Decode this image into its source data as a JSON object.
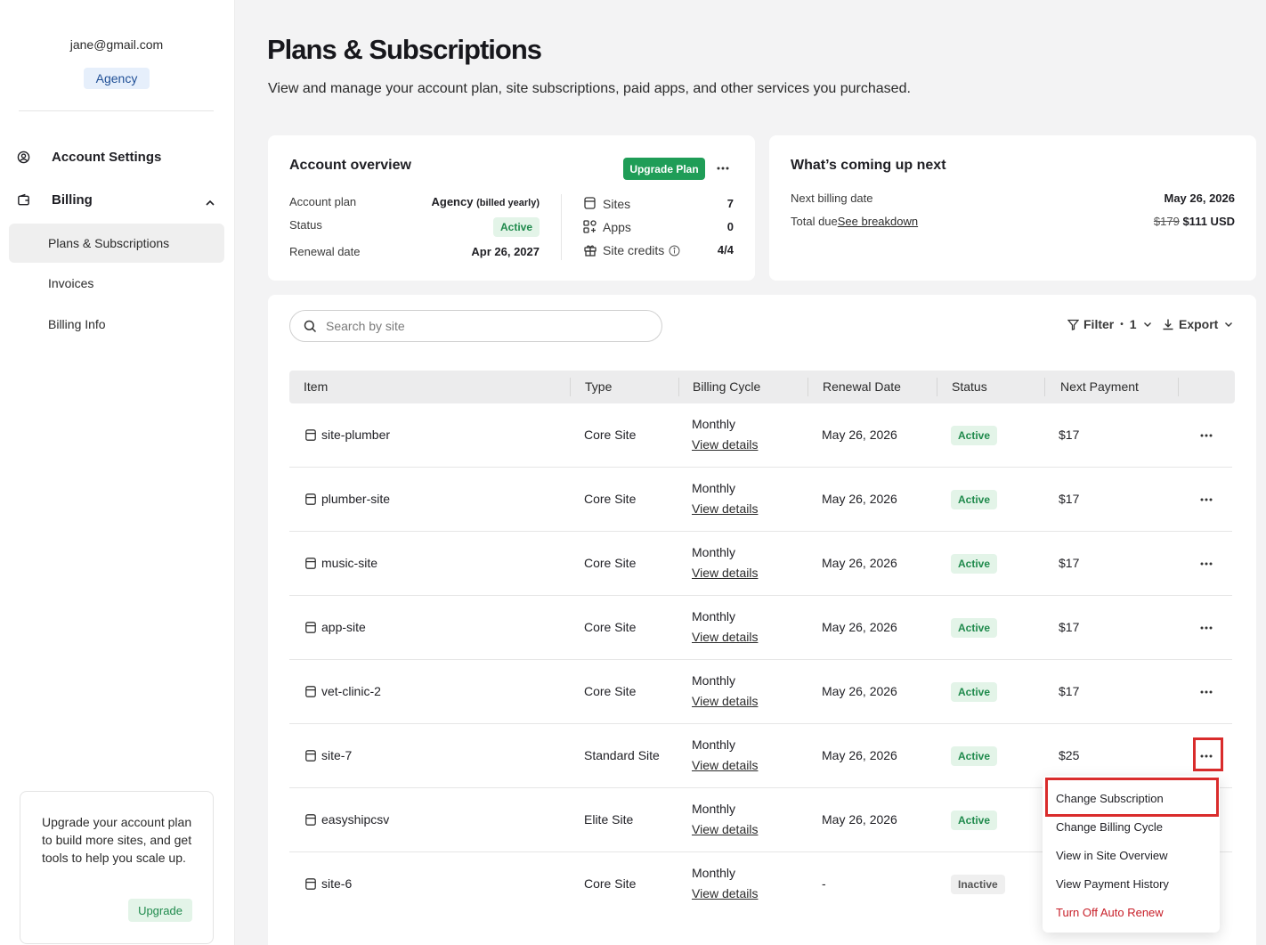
{
  "sidebar": {
    "email": "jane@gmail.com",
    "plan_badge": "Agency",
    "nav": {
      "account_settings": "Account Settings",
      "billing": "Billing"
    },
    "billing_items": [
      "Plans & Subscriptions",
      "Invoices",
      "Billing Info"
    ],
    "upgrade_card": {
      "text": "Upgrade your account plan to build more sites, and get tools to help you scale up.",
      "button": "Upgrade"
    }
  },
  "header": {
    "title": "Plans & Subscriptions",
    "subtitle": "View and manage your account plan, site subscriptions, paid apps, and other services you purchased."
  },
  "overview": {
    "title": "Account overview",
    "upgrade_button": "Upgrade Plan",
    "account_plan_label": "Account plan",
    "account_plan_value": "Agency",
    "account_plan_note": "(billed yearly)",
    "status_label": "Status",
    "status_value": "Active",
    "renewal_label": "Renewal date",
    "renewal_value": "Apr 26, 2027",
    "sites_label": "Sites",
    "sites_value": "7",
    "apps_label": "Apps",
    "apps_value": "0",
    "credits_label": "Site credits",
    "credits_value": "4/4"
  },
  "upcoming": {
    "title": "What’s coming up next",
    "next_billing_label": "Next billing date",
    "next_billing_value": "May 26, 2026",
    "total_due_label": "Total due",
    "breakdown_link": "See breakdown",
    "old_price": "$179",
    "new_price": "$111 USD"
  },
  "toolbar": {
    "search_placeholder": "Search by site",
    "filter_label": "Filter",
    "filter_count": "1",
    "export_label": "Export"
  },
  "table": {
    "headers": [
      "Item",
      "Type",
      "Billing Cycle",
      "Renewal Date",
      "Status",
      "Next Payment"
    ],
    "view_details": "View details",
    "rows": [
      {
        "item": "site-plumber",
        "type": "Core Site",
        "cycle": "Monthly",
        "renewal": "May 26, 2026",
        "status": "Active",
        "payment": "$17"
      },
      {
        "item": "plumber-site",
        "type": "Core Site",
        "cycle": "Monthly",
        "renewal": "May 26, 2026",
        "status": "Active",
        "payment": "$17"
      },
      {
        "item": "music-site",
        "type": "Core Site",
        "cycle": "Monthly",
        "renewal": "May 26, 2026",
        "status": "Active",
        "payment": "$17"
      },
      {
        "item": "app-site",
        "type": "Core Site",
        "cycle": "Monthly",
        "renewal": "May 26, 2026",
        "status": "Active",
        "payment": "$17"
      },
      {
        "item": "vet-clinic-2",
        "type": "Core Site",
        "cycle": "Monthly",
        "renewal": "May 26, 2026",
        "status": "Active",
        "payment": "$17"
      },
      {
        "item": "site-7",
        "type": "Standard Site",
        "cycle": "Monthly",
        "renewal": "May 26, 2026",
        "status": "Active",
        "payment": "$25"
      },
      {
        "item": "easyshipcsv",
        "type": "Elite Site",
        "cycle": "Monthly",
        "renewal": "May 26, 2026",
        "status": "Active",
        "payment": ""
      },
      {
        "item": "site-6",
        "type": "Core Site",
        "cycle": "Monthly",
        "renewal": "-",
        "status": "Inactive",
        "payment": ""
      }
    ]
  },
  "row_menu": {
    "items": [
      "Change Subscription",
      "Change Billing Cycle",
      "View in Site Overview",
      "View Payment History",
      "Turn Off Auto Renew"
    ]
  },
  "colors": {
    "accent_green": "#1f9d57",
    "active_badge_bg": "#e3f4e8",
    "danger": "#c8202a",
    "highlight": "#d92c2c"
  }
}
